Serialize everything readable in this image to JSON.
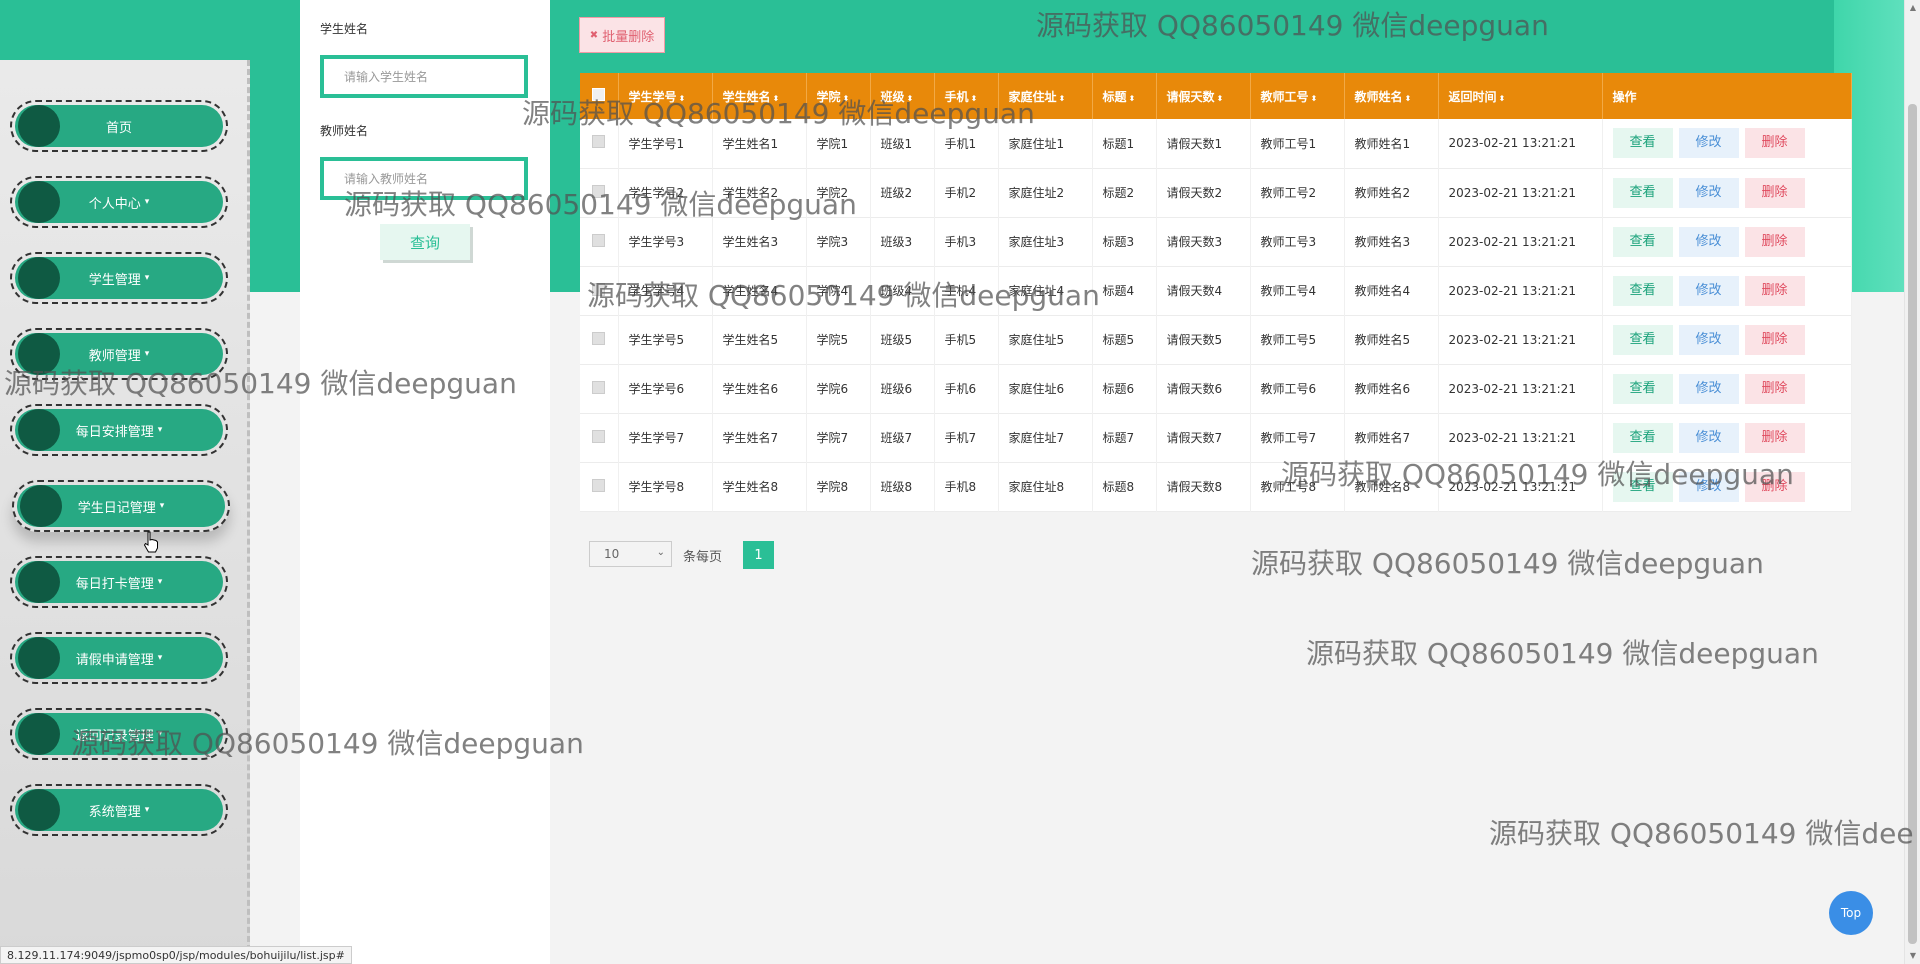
{
  "sidebar": {
    "items": [
      {
        "label": "首页",
        "has_caret": false
      },
      {
        "label": "个人中心",
        "has_caret": true
      },
      {
        "label": "学生管理",
        "has_caret": true
      },
      {
        "label": "教师管理",
        "has_caret": true
      },
      {
        "label": "每日安排管理",
        "has_caret": true
      },
      {
        "label": "学生日记管理",
        "has_caret": true
      },
      {
        "label": "每日打卡管理",
        "has_caret": true
      },
      {
        "label": "请假申请管理",
        "has_caret": true
      },
      {
        "label": "返回记录管理",
        "has_caret": true
      },
      {
        "label": "系统管理",
        "has_caret": true
      }
    ],
    "caret": "▾"
  },
  "search": {
    "student_label": "学生姓名",
    "student_placeholder": "请输入学生姓名",
    "teacher_label": "教师姓名",
    "teacher_placeholder": "请输入教师姓名",
    "query_label": "查询"
  },
  "toolbar": {
    "batch_delete_icon": "✖",
    "batch_delete_label": "批量删除"
  },
  "table": {
    "sort_icon": "⬍",
    "columns": [
      "学生学号",
      "学生姓名",
      "学院",
      "班级",
      "手机",
      "家庭住址",
      "标题",
      "请假天数",
      "教师工号",
      "教师姓名",
      "返回时间",
      "操作"
    ],
    "rows": [
      [
        "学生学号1",
        "学生姓名1",
        "学院1",
        "班级1",
        "手机1",
        "家庭住址1",
        "标题1",
        "请假天数1",
        "教师工号1",
        "教师姓名1",
        "2023-02-21 13:21:21"
      ],
      [
        "学生学号2",
        "学生姓名2",
        "学院2",
        "班级2",
        "手机2",
        "家庭住址2",
        "标题2",
        "请假天数2",
        "教师工号2",
        "教师姓名2",
        "2023-02-21 13:21:21"
      ],
      [
        "学生学号3",
        "学生姓名3",
        "学院3",
        "班级3",
        "手机3",
        "家庭住址3",
        "标题3",
        "请假天数3",
        "教师工号3",
        "教师姓名3",
        "2023-02-21 13:21:21"
      ],
      [
        "学生学号4",
        "学生姓名4",
        "学院4",
        "班级4",
        "手机4",
        "家庭住址4",
        "标题4",
        "请假天数4",
        "教师工号4",
        "教师姓名4",
        "2023-02-21 13:21:21"
      ],
      [
        "学生学号5",
        "学生姓名5",
        "学院5",
        "班级5",
        "手机5",
        "家庭住址5",
        "标题5",
        "请假天数5",
        "教师工号5",
        "教师姓名5",
        "2023-02-21 13:21:21"
      ],
      [
        "学生学号6",
        "学生姓名6",
        "学院6",
        "班级6",
        "手机6",
        "家庭住址6",
        "标题6",
        "请假天数6",
        "教师工号6",
        "教师姓名6",
        "2023-02-21 13:21:21"
      ],
      [
        "学生学号7",
        "学生姓名7",
        "学院7",
        "班级7",
        "手机7",
        "家庭住址7",
        "标题7",
        "请假天数7",
        "教师工号7",
        "教师姓名7",
        "2023-02-21 13:21:21"
      ],
      [
        "学生学号8",
        "学生姓名8",
        "学院8",
        "班级8",
        "手机8",
        "家庭住址8",
        "标题8",
        "请假天数8",
        "教师工号8",
        "教师姓名8",
        "2023-02-21 13:21:21"
      ]
    ],
    "actions": {
      "view": "查看",
      "edit": "修改",
      "delete": "删除"
    }
  },
  "pagination": {
    "page_size": "10",
    "page_size_suffix": "条每页",
    "current_page": "1"
  },
  "top_button": "Top",
  "status_url": "8.129.11.174:9049/jspmo0sp0/jsp/modules/bohuijilu/list.jsp#",
  "watermark": "源码获取 QQ86050149 微信deepguan",
  "watermark_partial": "源码获取 QQ86050149 微信dee",
  "colors": {
    "teal": "#2abf96",
    "nav_pill": "#27a983",
    "nav_dot": "#0f5a43",
    "table_header": "#e8890a",
    "top_button": "#3a8ee6"
  }
}
